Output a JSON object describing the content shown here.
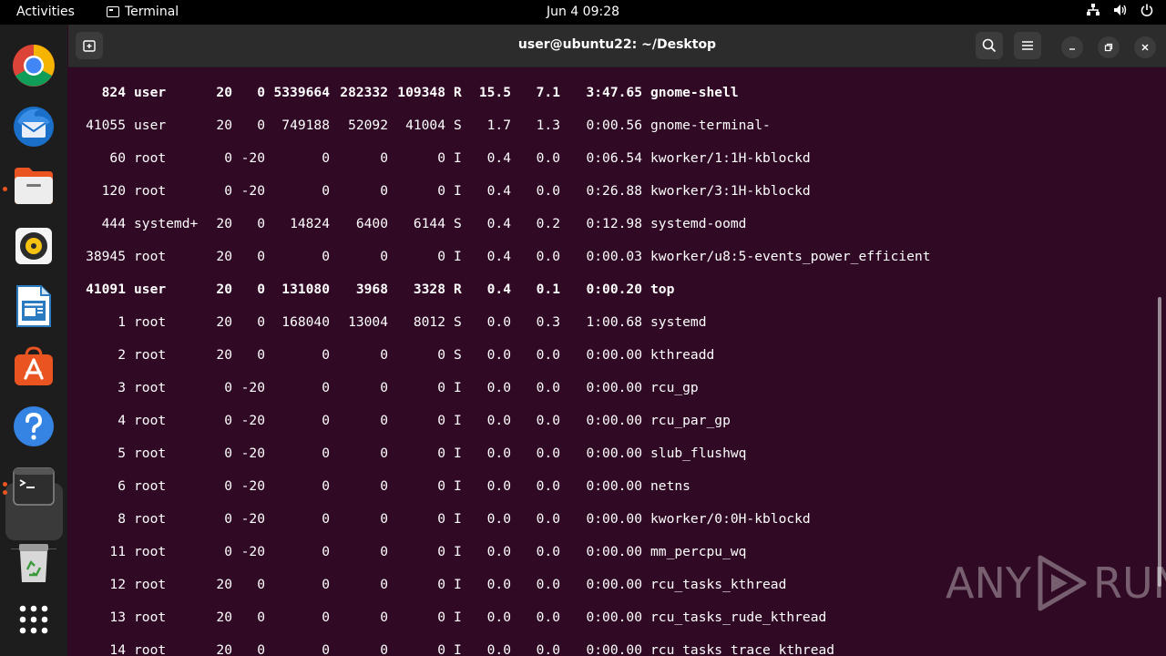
{
  "topbar": {
    "activities": "Activities",
    "app_name": "Terminal",
    "clock": "Jun 4  09:28"
  },
  "dock": {
    "apps": [
      {
        "name": "chrome-icon"
      },
      {
        "name": "thunderbird-icon"
      },
      {
        "name": "files-icon"
      },
      {
        "name": "rhythmbox-icon"
      },
      {
        "name": "libreoffice-writer-icon"
      },
      {
        "name": "app-center-icon"
      },
      {
        "name": "help-icon"
      },
      {
        "name": "terminal-icon"
      },
      {
        "name": "trash-icon"
      },
      {
        "name": "show-apps-icon"
      }
    ]
  },
  "window": {
    "title": "user@ubuntu22: ~/Desktop"
  },
  "processes": [
    {
      "pid": "824",
      "user": "user",
      "pr": "20",
      "ni": "0",
      "virt": "5339664",
      "res": "282332",
      "shr": "109348",
      "s": "R",
      "cpu": "15.5",
      "mem": "7.1",
      "time": "3:47.65",
      "command": "gnome-shell",
      "bold": true
    },
    {
      "pid": "41055",
      "user": "user",
      "pr": "20",
      "ni": "0",
      "virt": "749188",
      "res": "52092",
      "shr": "41004",
      "s": "S",
      "cpu": "1.7",
      "mem": "1.3",
      "time": "0:00.56",
      "command": "gnome-terminal-",
      "bold": false
    },
    {
      "pid": "60",
      "user": "root",
      "pr": "0",
      "ni": "-20",
      "virt": "0",
      "res": "0",
      "shr": "0",
      "s": "I",
      "cpu": "0.4",
      "mem": "0.0",
      "time": "0:06.54",
      "command": "kworker/1:1H-kblockd",
      "bold": false
    },
    {
      "pid": "120",
      "user": "root",
      "pr": "0",
      "ni": "-20",
      "virt": "0",
      "res": "0",
      "shr": "0",
      "s": "I",
      "cpu": "0.4",
      "mem": "0.0",
      "time": "0:26.88",
      "command": "kworker/3:1H-kblockd",
      "bold": false
    },
    {
      "pid": "444",
      "user": "systemd+",
      "pr": "20",
      "ni": "0",
      "virt": "14824",
      "res": "6400",
      "shr": "6144",
      "s": "S",
      "cpu": "0.4",
      "mem": "0.2",
      "time": "0:12.98",
      "command": "systemd-oomd",
      "bold": false
    },
    {
      "pid": "38945",
      "user": "root",
      "pr": "20",
      "ni": "0",
      "virt": "0",
      "res": "0",
      "shr": "0",
      "s": "I",
      "cpu": "0.4",
      "mem": "0.0",
      "time": "0:00.03",
      "command": "kworker/u8:5-events_power_efficient",
      "bold": false
    },
    {
      "pid": "41091",
      "user": "user",
      "pr": "20",
      "ni": "0",
      "virt": "131080",
      "res": "3968",
      "shr": "3328",
      "s": "R",
      "cpu": "0.4",
      "mem": "0.1",
      "time": "0:00.20",
      "command": "top",
      "bold": true
    },
    {
      "pid": "1",
      "user": "root",
      "pr": "20",
      "ni": "0",
      "virt": "168040",
      "res": "13004",
      "shr": "8012",
      "s": "S",
      "cpu": "0.0",
      "mem": "0.3",
      "time": "1:00.68",
      "command": "systemd",
      "bold": false
    },
    {
      "pid": "2",
      "user": "root",
      "pr": "20",
      "ni": "0",
      "virt": "0",
      "res": "0",
      "shr": "0",
      "s": "S",
      "cpu": "0.0",
      "mem": "0.0",
      "time": "0:00.00",
      "command": "kthreadd",
      "bold": false
    },
    {
      "pid": "3",
      "user": "root",
      "pr": "0",
      "ni": "-20",
      "virt": "0",
      "res": "0",
      "shr": "0",
      "s": "I",
      "cpu": "0.0",
      "mem": "0.0",
      "time": "0:00.00",
      "command": "rcu_gp",
      "bold": false
    },
    {
      "pid": "4",
      "user": "root",
      "pr": "0",
      "ni": "-20",
      "virt": "0",
      "res": "0",
      "shr": "0",
      "s": "I",
      "cpu": "0.0",
      "mem": "0.0",
      "time": "0:00.00",
      "command": "rcu_par_gp",
      "bold": false
    },
    {
      "pid": "5",
      "user": "root",
      "pr": "0",
      "ni": "-20",
      "virt": "0",
      "res": "0",
      "shr": "0",
      "s": "I",
      "cpu": "0.0",
      "mem": "0.0",
      "time": "0:00.00",
      "command": "slub_flushwq",
      "bold": false
    },
    {
      "pid": "6",
      "user": "root",
      "pr": "0",
      "ni": "-20",
      "virt": "0",
      "res": "0",
      "shr": "0",
      "s": "I",
      "cpu": "0.0",
      "mem": "0.0",
      "time": "0:00.00",
      "command": "netns",
      "bold": false
    },
    {
      "pid": "8",
      "user": "root",
      "pr": "0",
      "ni": "-20",
      "virt": "0",
      "res": "0",
      "shr": "0",
      "s": "I",
      "cpu": "0.0",
      "mem": "0.0",
      "time": "0:00.00",
      "command": "kworker/0:0H-kblockd",
      "bold": false
    },
    {
      "pid": "11",
      "user": "root",
      "pr": "0",
      "ni": "-20",
      "virt": "0",
      "res": "0",
      "shr": "0",
      "s": "I",
      "cpu": "0.0",
      "mem": "0.0",
      "time": "0:00.00",
      "command": "mm_percpu_wq",
      "bold": false
    },
    {
      "pid": "12",
      "user": "root",
      "pr": "20",
      "ni": "0",
      "virt": "0",
      "res": "0",
      "shr": "0",
      "s": "I",
      "cpu": "0.0",
      "mem": "0.0",
      "time": "0:00.00",
      "command": "rcu_tasks_kthread",
      "bold": false
    },
    {
      "pid": "13",
      "user": "root",
      "pr": "20",
      "ni": "0",
      "virt": "0",
      "res": "0",
      "shr": "0",
      "s": "I",
      "cpu": "0.0",
      "mem": "0.0",
      "time": "0:00.00",
      "command": "rcu_tasks_rude_kthread",
      "bold": false
    },
    {
      "pid": "14",
      "user": "root",
      "pr": "20",
      "ni": "0",
      "virt": "0",
      "res": "0",
      "shr": "0",
      "s": "I",
      "cpu": "0.0",
      "mem": "0.0",
      "time": "0:00.00",
      "command": "rcu_tasks_trace_kthread",
      "bold": false
    }
  ],
  "watermark": {
    "left": "ANY",
    "right": "RUN"
  }
}
